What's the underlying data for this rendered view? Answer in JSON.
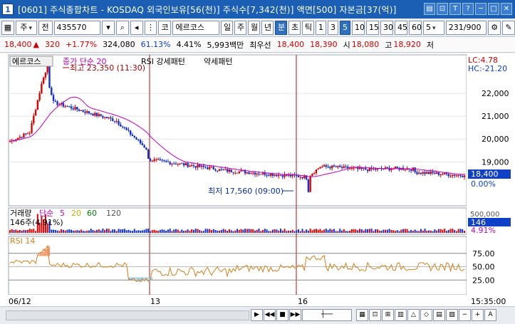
{
  "window": {
    "number": "1",
    "title": "[0601] 주식종합차트 - KOSDAQ 외국인보유[56(천)] 주식수[7,342(천)] 액면[500] 자본금[37(억)]",
    "title_buttons": [
      "▤",
      "⊡",
      "T",
      "?",
      "─",
      "□",
      "✕"
    ]
  },
  "toolbar": {
    "market_label": "주",
    "all_label": "전",
    "code_value": "435570",
    "kospi_kosdaq_label": "코",
    "stock_name": "에르코스",
    "period_buttons": [
      "일",
      "주",
      "월",
      "년",
      "분",
      "초",
      "틱"
    ],
    "active_period": "분",
    "minute_buttons": [
      "1",
      "3",
      "5",
      "10",
      "15",
      "30",
      "45",
      "60"
    ],
    "active_minute": "5",
    "interval_value": "5",
    "count_value": "231",
    "count_total": "/900"
  },
  "quote": {
    "price": "18,400",
    "change_sign": "▲",
    "change": "320",
    "change_pct": "+1.77%",
    "volume": "324,080",
    "vol_ratio": "61.13%",
    "turnover": "4.41%",
    "amount": "5,993백만",
    "best_ask_label": "최우선",
    "best_ask": "18,400",
    "best_bid": "18,390",
    "open_label": "시",
    "open": "18,080",
    "high_label": "고",
    "high": "18,920",
    "low_label": "저"
  },
  "price_panel": {
    "stock_tab": "에르코스",
    "ma_label": "종가 단순 20",
    "pattern_label": "RSI 강세패턴",
    "pattern_label2": "약세패턴",
    "high_annotation": "최고 23,350 (11:30)",
    "low_annotation": "최저 17,560 (09:00)",
    "lc": "LC:4.78",
    "hc": "HC:-21.20",
    "y_ticks": [
      "22,000",
      "21,000",
      "20,000",
      "19,000"
    ],
    "current_price_tag": "18,400",
    "current_pct_tag": "0.00%"
  },
  "volume_panel": {
    "label": "거래량",
    "ma_label": "단순",
    "ma_values": [
      "5",
      "20",
      "60",
      "120"
    ],
    "sub_label": "146주(4.91%)",
    "axis_tick": "500,000",
    "current_tag": "146",
    "current_pct_tag": "4.91%"
  },
  "rsi_panel": {
    "label": "RSI 14",
    "y_ticks": [
      "75.00",
      "50.00",
      "25.00"
    ]
  },
  "x_axis": {
    "labels": [
      "06/12",
      "13",
      "16"
    ],
    "time_label": "15:35:00"
  },
  "colors": {
    "up": "#e00000",
    "down": "#1030d0",
    "ma": "#c000c0",
    "rsi_line": "#d4801a",
    "rsi_fill_over": "#f4a07a",
    "rsi_fill_under": "#9fd0ee",
    "divider": "#b01010"
  },
  "chart_data": {
    "type": "candlestick",
    "price_range": [
      17200,
      23500
    ],
    "rsi_range": [
      0,
      100
    ],
    "key_points": {
      "high": 23350,
      "low": 17560,
      "last": 18400
    },
    "rsi_reference": [
      75,
      50,
      25
    ]
  }
}
